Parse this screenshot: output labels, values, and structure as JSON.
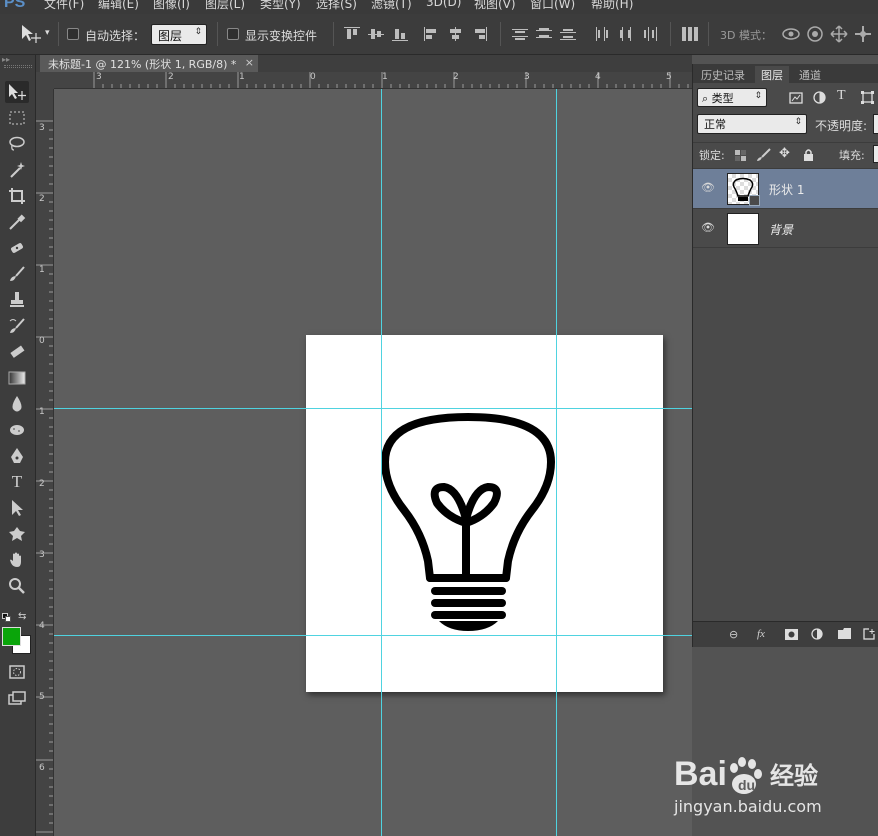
{
  "app": {
    "logo": "PS"
  },
  "menu": [
    "文件(F)",
    "编辑(E)",
    "图像(I)",
    "图层(L)",
    "类型(Y)",
    "选择(S)",
    "滤镜(T)",
    "3D(D)",
    "视图(V)",
    "窗口(W)",
    "帮助(H)"
  ],
  "options": {
    "auto_select_label": "自动选择：",
    "auto_select_value": "图层",
    "show_transform_label": "显示变换控件",
    "mode3d_label": "3D 模式："
  },
  "document_tab": {
    "title": "未标题-1 @ 121% (形状 1, RGB/8) *",
    "close": "×"
  },
  "ruler_h_labels": [
    "3",
    "2",
    "1",
    "0",
    "1",
    "2",
    "3",
    "4",
    "5"
  ],
  "ruler_v_labels": [
    "3",
    "2",
    "1",
    "0",
    "1",
    "2",
    "3",
    "4",
    "5",
    "6"
  ],
  "colors": {
    "foreground": "#0aa50a",
    "background": "#ffffff",
    "guide": "#4fd3e0",
    "selected_layer": "#6e7f99"
  },
  "panel": {
    "tabs": [
      "历史记录",
      "图层",
      "通道"
    ],
    "filter_label": "类型",
    "blend_mode": "正常",
    "opacity_label": "不透明度:",
    "lock_label": "锁定:",
    "fill_label": "填充:",
    "layers": [
      {
        "name": "形状 1",
        "selected": true
      },
      {
        "name": "背景",
        "selected": false
      }
    ]
  },
  "watermark": {
    "brand": "Bai 经验",
    "url": "jingyan.baidu.com"
  }
}
